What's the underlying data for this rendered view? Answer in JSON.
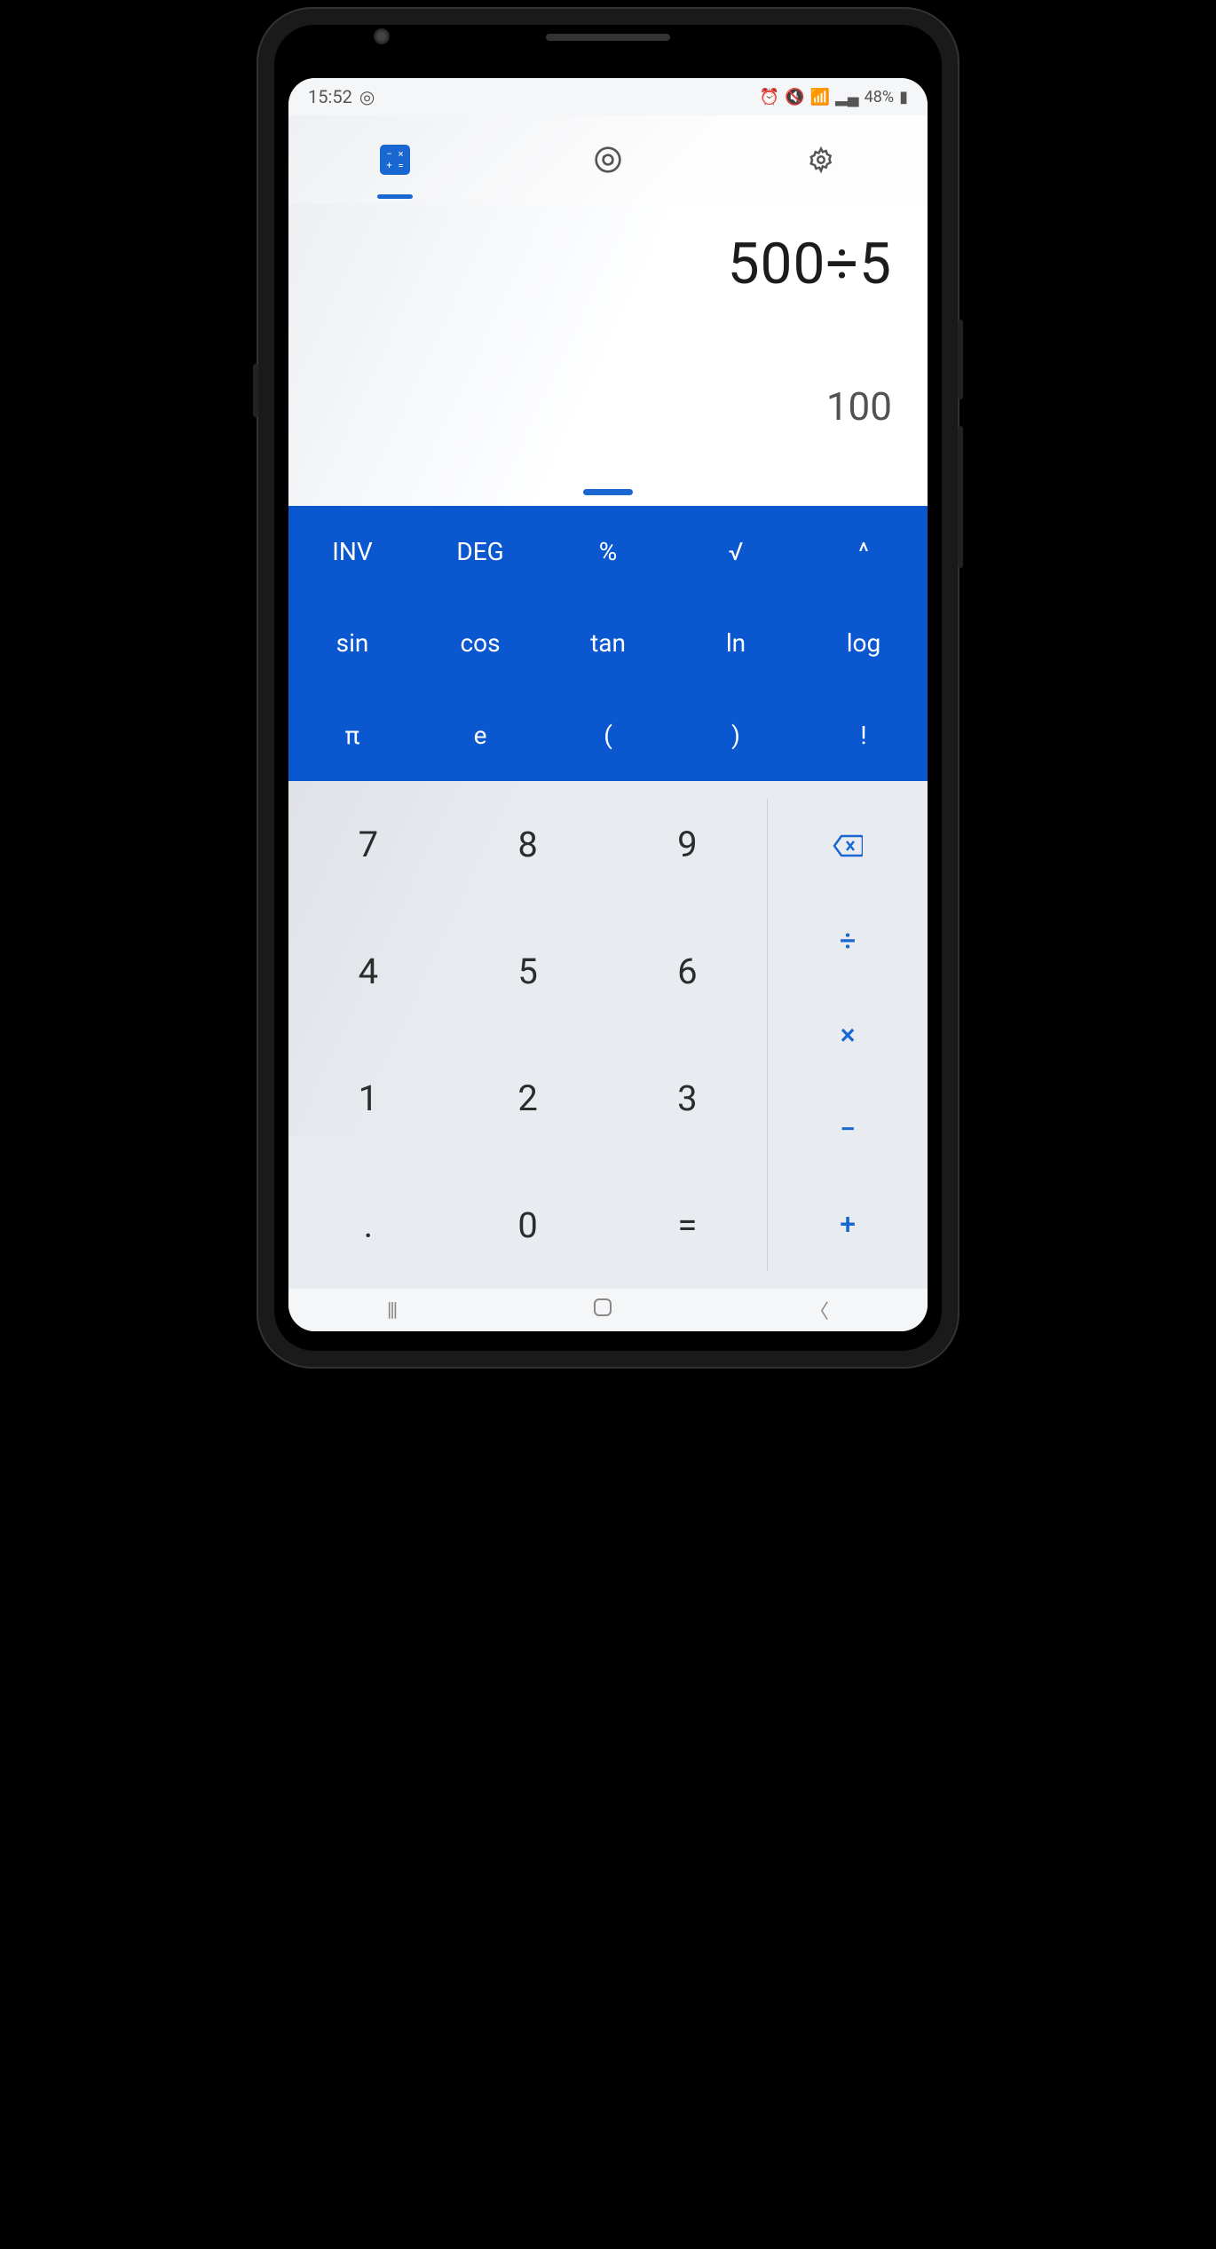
{
  "status": {
    "time": "15:52",
    "battery": "48%",
    "icons_left": "◎ ⓘ",
    "icons_right": "⏰ 🔇 📶 📶"
  },
  "display": {
    "expression": "500÷5",
    "result": "100"
  },
  "sci": {
    "r0": [
      "INV",
      "DEG",
      "%",
      "√",
      "^"
    ],
    "r1": [
      "sin",
      "cos",
      "tan",
      "ln",
      "log"
    ],
    "r2": [
      "π",
      "e",
      "(",
      ")",
      "!"
    ]
  },
  "numpad": {
    "r0": [
      "7",
      "8",
      "9"
    ],
    "r1": [
      "4",
      "5",
      "6"
    ],
    "r2": [
      "1",
      "2",
      "3"
    ],
    "r3": [
      ".",
      "0",
      "="
    ]
  },
  "ops": {
    "backspace": "⌫",
    "divide": "÷",
    "multiply": "×",
    "minus": "−",
    "plus": "+"
  },
  "nav": {
    "recent": "|||",
    "home": "◯",
    "back": "〈"
  }
}
